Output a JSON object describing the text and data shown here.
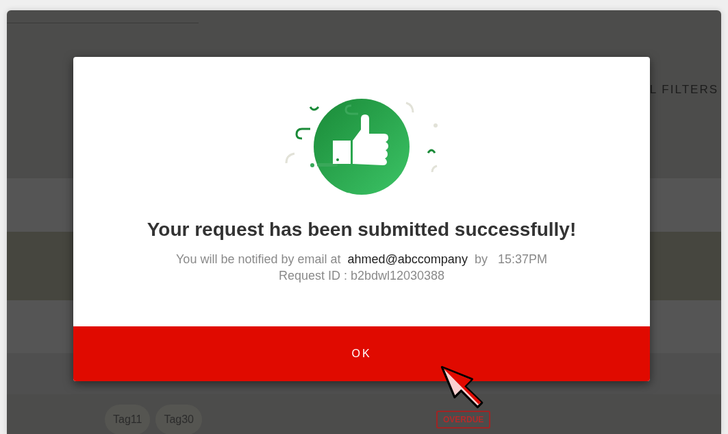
{
  "background_page": {
    "filter_label": "L FILTERS",
    "tags": [
      "Tag11",
      "Tag30"
    ],
    "status_badge": "OVERDUE"
  },
  "dialog": {
    "title": "Your request has been submitted successfully!",
    "message_prefix": "You will be notified by email at",
    "email": "ahmed@abccompany",
    "message_by": "by",
    "time": "15:37PM",
    "request_id": "Request ID : b2bdwl12030388",
    "ok_button": "OK"
  }
}
